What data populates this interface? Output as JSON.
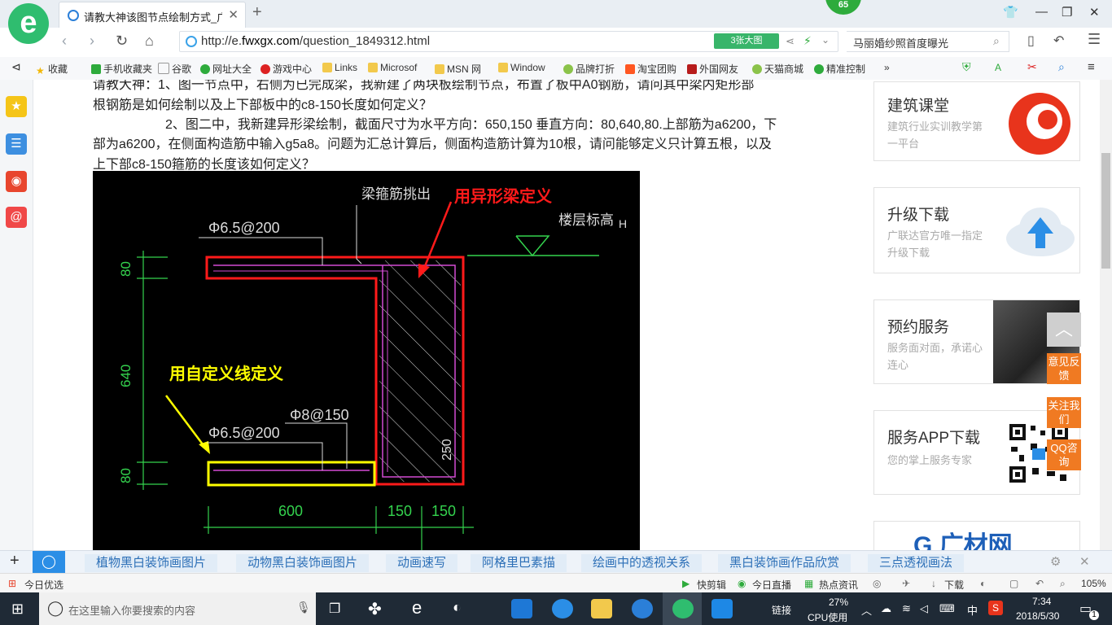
{
  "browser": {
    "tab_title": "请教大神该图节点绘制方式_广联达",
    "badge": "65",
    "url_prefix": "http://e.",
    "url_domain": "fwxgx.com",
    "url_path": "/question_1849312.html",
    "big_image_label": "3张大图",
    "search_query": "马丽婚纱照首度曝光"
  },
  "bookmarks": [
    "收藏",
    "手机收藏夹",
    "谷歌",
    "网址大全",
    "游戏中心",
    "Links",
    "Microsof",
    "MSN 网",
    "Window",
    "品牌打折",
    "淘宝团购",
    "外国网友",
    "天猫商城",
    "精准控制"
  ],
  "question": {
    "line1": "请教大神：1、图一节点中，右侧为已完成梁，我新建了两块板绘制节点，布置了板中A0钢筋，请问其中梁内矩形部",
    "line2": "根钢筋是如何绘制以及上下部板中的c8-150长度如何定义？",
    "line3": "2、图二中，我新建异形梁绘制，截面尺寸为水平方向：650,150 垂直方向：80,640,80.上部筋为a6200，下",
    "line4": "部为a6200，在侧面构造筋中输入g5a8。问题为汇总计算后，侧面构造筋计算为10根，请问能够定义只计算五根，以及",
    "line5": "上下部c8-150箍筋的长度该如何定义？"
  },
  "cad": {
    "label_stirrup_out": "梁箍筋挑出",
    "label_special_beam": "用异形梁定义",
    "label_floor_elev": "楼层标高",
    "label_H": "H",
    "label_top_rebar": "Φ6.5@200",
    "label_custom_line": "用自定义线定义",
    "label_phi8": "Φ8@150",
    "label_bottom_rebar": "Φ6.5@200",
    "dim_80_top": "80",
    "dim_640": "640",
    "dim_80_bottom": "80",
    "dim_250": "250",
    "dim_600": "600",
    "dim_150_a": "150",
    "dim_150_b": "150",
    "colors": {
      "red": "#ff1a1a",
      "yellow": "#ffff00",
      "green": "#34d34e",
      "magenta": "#d24bd2",
      "white": "#dddddd"
    }
  },
  "panels": [
    {
      "title": "建筑课堂",
      "desc": "建筑行业实训教学第一平台"
    },
    {
      "title": "升级下载",
      "desc": "广联达官方唯一指定升级下载"
    },
    {
      "title": "预约服务",
      "desc": "服务面对面，承诺心连心"
    },
    {
      "title": "服务APP下载",
      "desc": "您的掌上服务专家"
    },
    {
      "title": "广材网"
    }
  ],
  "float_buttons": [
    "意见反馈",
    "关注我们",
    "QQ咨询"
  ],
  "hotbar": [
    "植物黑白装饰画图片",
    "动物黑白装饰画图片",
    "动画速写",
    "阿格里巴素描",
    "绘画中的透视关系",
    "黑白装饰画作品欣赏",
    "三点透视画法"
  ],
  "statusbar": {
    "left": "今日优选",
    "items": [
      "快剪辑",
      "今日直播",
      "热点资讯",
      "下载"
    ],
    "zoom": "105%"
  },
  "taskbar": {
    "search_placeholder": "在这里输入你要搜索的内容",
    "link": "链接",
    "cpu_percent": "27%",
    "cpu_label": "CPU使用",
    "ime": "中",
    "time": "7:34",
    "date": "2018/5/30",
    "notif": "1"
  }
}
